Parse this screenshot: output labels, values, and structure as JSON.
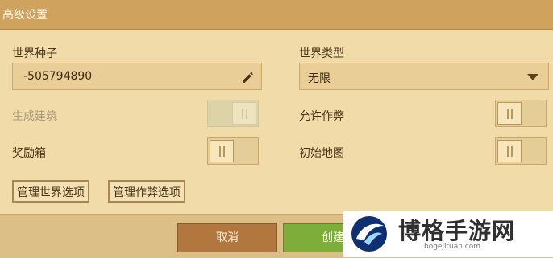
{
  "dialog": {
    "title": "高级设置"
  },
  "seed": {
    "label": "世界种子",
    "value": "-505794890",
    "edit_icon": "pencil-icon"
  },
  "world_type": {
    "label": "世界类型",
    "value": "无限",
    "dropdown_icon": "chevron-down-icon"
  },
  "options": {
    "generate_structures": {
      "label": "生成建筑",
      "state": "on",
      "enabled": false
    },
    "allow_cheats": {
      "label": "允许作弊",
      "state": "off",
      "enabled": true
    },
    "bonus_chest": {
      "label": "奖励箱",
      "state": "off",
      "enabled": true
    },
    "starting_map": {
      "label": "初始地图",
      "state": "off",
      "enabled": true
    }
  },
  "buttons": {
    "manage_world": "管理世界选项",
    "manage_cheats": "管理作弊选项",
    "cancel": "取消",
    "create": "创建"
  },
  "watermark": {
    "title": "博格手游网",
    "subtitle": "bogejituan.com"
  },
  "colors": {
    "title_bar": "#cfa25e",
    "panel": "#f1dba9",
    "cancel": "#b2773f",
    "create": "#7fad3a"
  }
}
